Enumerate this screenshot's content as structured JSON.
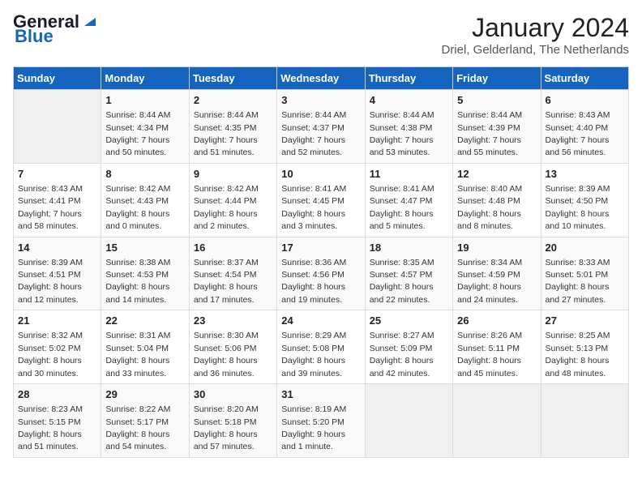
{
  "logo": {
    "line1": "General",
    "line2": "Blue"
  },
  "header": {
    "month": "January 2024",
    "location": "Driel, Gelderland, The Netherlands"
  },
  "columns": [
    "Sunday",
    "Monday",
    "Tuesday",
    "Wednesday",
    "Thursday",
    "Friday",
    "Saturday"
  ],
  "weeks": [
    [
      {
        "day": "",
        "sunrise": "",
        "sunset": "",
        "daylight": "",
        "empty": true
      },
      {
        "day": "1",
        "sunrise": "Sunrise: 8:44 AM",
        "sunset": "Sunset: 4:34 PM",
        "daylight": "Daylight: 7 hours and 50 minutes."
      },
      {
        "day": "2",
        "sunrise": "Sunrise: 8:44 AM",
        "sunset": "Sunset: 4:35 PM",
        "daylight": "Daylight: 7 hours and 51 minutes."
      },
      {
        "day": "3",
        "sunrise": "Sunrise: 8:44 AM",
        "sunset": "Sunset: 4:37 PM",
        "daylight": "Daylight: 7 hours and 52 minutes."
      },
      {
        "day": "4",
        "sunrise": "Sunrise: 8:44 AM",
        "sunset": "Sunset: 4:38 PM",
        "daylight": "Daylight: 7 hours and 53 minutes."
      },
      {
        "day": "5",
        "sunrise": "Sunrise: 8:44 AM",
        "sunset": "Sunset: 4:39 PM",
        "daylight": "Daylight: 7 hours and 55 minutes."
      },
      {
        "day": "6",
        "sunrise": "Sunrise: 8:43 AM",
        "sunset": "Sunset: 4:40 PM",
        "daylight": "Daylight: 7 hours and 56 minutes."
      }
    ],
    [
      {
        "day": "7",
        "sunrise": "Sunrise: 8:43 AM",
        "sunset": "Sunset: 4:41 PM",
        "daylight": "Daylight: 7 hours and 58 minutes."
      },
      {
        "day": "8",
        "sunrise": "Sunrise: 8:42 AM",
        "sunset": "Sunset: 4:43 PM",
        "daylight": "Daylight: 8 hours and 0 minutes."
      },
      {
        "day": "9",
        "sunrise": "Sunrise: 8:42 AM",
        "sunset": "Sunset: 4:44 PM",
        "daylight": "Daylight: 8 hours and 2 minutes."
      },
      {
        "day": "10",
        "sunrise": "Sunrise: 8:41 AM",
        "sunset": "Sunset: 4:45 PM",
        "daylight": "Daylight: 8 hours and 3 minutes."
      },
      {
        "day": "11",
        "sunrise": "Sunrise: 8:41 AM",
        "sunset": "Sunset: 4:47 PM",
        "daylight": "Daylight: 8 hours and 5 minutes."
      },
      {
        "day": "12",
        "sunrise": "Sunrise: 8:40 AM",
        "sunset": "Sunset: 4:48 PM",
        "daylight": "Daylight: 8 hours and 8 minutes."
      },
      {
        "day": "13",
        "sunrise": "Sunrise: 8:39 AM",
        "sunset": "Sunset: 4:50 PM",
        "daylight": "Daylight: 8 hours and 10 minutes."
      }
    ],
    [
      {
        "day": "14",
        "sunrise": "Sunrise: 8:39 AM",
        "sunset": "Sunset: 4:51 PM",
        "daylight": "Daylight: 8 hours and 12 minutes."
      },
      {
        "day": "15",
        "sunrise": "Sunrise: 8:38 AM",
        "sunset": "Sunset: 4:53 PM",
        "daylight": "Daylight: 8 hours and 14 minutes."
      },
      {
        "day": "16",
        "sunrise": "Sunrise: 8:37 AM",
        "sunset": "Sunset: 4:54 PM",
        "daylight": "Daylight: 8 hours and 17 minutes."
      },
      {
        "day": "17",
        "sunrise": "Sunrise: 8:36 AM",
        "sunset": "Sunset: 4:56 PM",
        "daylight": "Daylight: 8 hours and 19 minutes."
      },
      {
        "day": "18",
        "sunrise": "Sunrise: 8:35 AM",
        "sunset": "Sunset: 4:57 PM",
        "daylight": "Daylight: 8 hours and 22 minutes."
      },
      {
        "day": "19",
        "sunrise": "Sunrise: 8:34 AM",
        "sunset": "Sunset: 4:59 PM",
        "daylight": "Daylight: 8 hours and 24 minutes."
      },
      {
        "day": "20",
        "sunrise": "Sunrise: 8:33 AM",
        "sunset": "Sunset: 5:01 PM",
        "daylight": "Daylight: 8 hours and 27 minutes."
      }
    ],
    [
      {
        "day": "21",
        "sunrise": "Sunrise: 8:32 AM",
        "sunset": "Sunset: 5:02 PM",
        "daylight": "Daylight: 8 hours and 30 minutes."
      },
      {
        "day": "22",
        "sunrise": "Sunrise: 8:31 AM",
        "sunset": "Sunset: 5:04 PM",
        "daylight": "Daylight: 8 hours and 33 minutes."
      },
      {
        "day": "23",
        "sunrise": "Sunrise: 8:30 AM",
        "sunset": "Sunset: 5:06 PM",
        "daylight": "Daylight: 8 hours and 36 minutes."
      },
      {
        "day": "24",
        "sunrise": "Sunrise: 8:29 AM",
        "sunset": "Sunset: 5:08 PM",
        "daylight": "Daylight: 8 hours and 39 minutes."
      },
      {
        "day": "25",
        "sunrise": "Sunrise: 8:27 AM",
        "sunset": "Sunset: 5:09 PM",
        "daylight": "Daylight: 8 hours and 42 minutes."
      },
      {
        "day": "26",
        "sunrise": "Sunrise: 8:26 AM",
        "sunset": "Sunset: 5:11 PM",
        "daylight": "Daylight: 8 hours and 45 minutes."
      },
      {
        "day": "27",
        "sunrise": "Sunrise: 8:25 AM",
        "sunset": "Sunset: 5:13 PM",
        "daylight": "Daylight: 8 hours and 48 minutes."
      }
    ],
    [
      {
        "day": "28",
        "sunrise": "Sunrise: 8:23 AM",
        "sunset": "Sunset: 5:15 PM",
        "daylight": "Daylight: 8 hours and 51 minutes."
      },
      {
        "day": "29",
        "sunrise": "Sunrise: 8:22 AM",
        "sunset": "Sunset: 5:17 PM",
        "daylight": "Daylight: 8 hours and 54 minutes."
      },
      {
        "day": "30",
        "sunrise": "Sunrise: 8:20 AM",
        "sunset": "Sunset: 5:18 PM",
        "daylight": "Daylight: 8 hours and 57 minutes."
      },
      {
        "day": "31",
        "sunrise": "Sunrise: 8:19 AM",
        "sunset": "Sunset: 5:20 PM",
        "daylight": "Daylight: 9 hours and 1 minute."
      },
      {
        "day": "",
        "sunrise": "",
        "sunset": "",
        "daylight": "",
        "empty": true
      },
      {
        "day": "",
        "sunrise": "",
        "sunset": "",
        "daylight": "",
        "empty": true
      },
      {
        "day": "",
        "sunrise": "",
        "sunset": "",
        "daylight": "",
        "empty": true
      }
    ]
  ]
}
